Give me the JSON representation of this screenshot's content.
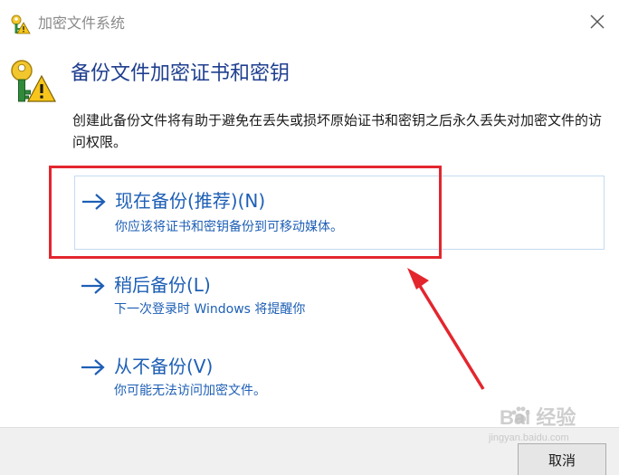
{
  "window": {
    "title": "加密文件系统",
    "close_icon": "close-icon"
  },
  "header": {
    "icon": "key-warning-icon",
    "title": "备份文件加密证书和密钥"
  },
  "description": "创建此备份文件将有助于避免在丢失或损坏原始证书和密钥之后永久丢失对加密文件的访问权限。",
  "options": [
    {
      "title": "现在备份(推荐)(N)",
      "description": "你应该将证书和密钥备份到可移动媒体。",
      "icon": "arrow-right-icon"
    },
    {
      "title": "稍后备份(L)",
      "description": "下一次登录时 Windows 将提醒你",
      "icon": "arrow-right-icon"
    },
    {
      "title": "从不备份(V)",
      "description": "你可能无法访问加密文件。",
      "icon": "arrow-right-icon"
    }
  ],
  "footer": {
    "cancel_label": "取消"
  },
  "watermark": {
    "text": "Bai  经验",
    "url": "jingyan.baidu.com"
  },
  "colors": {
    "link_blue": "#1e5fb5",
    "header_blue": "#1f3f8f",
    "highlight_red": "#e3262e"
  }
}
